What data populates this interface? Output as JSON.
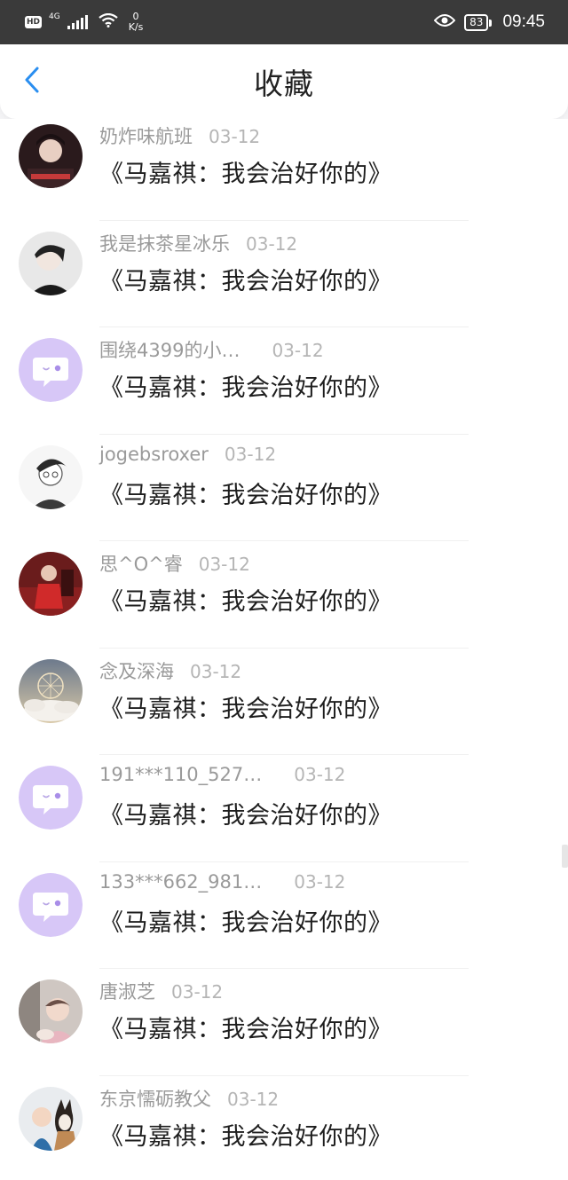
{
  "status_bar": {
    "hd": "HD",
    "network": "4G",
    "speed_value": "0",
    "speed_unit": "K/s",
    "battery": "83",
    "time": "09:45"
  },
  "header": {
    "title": "收藏"
  },
  "favorites": [
    {
      "name": "奶炸味航班",
      "date": "03-12",
      "content": "《马嘉祺：我会治好你的》",
      "avatar": "photo"
    },
    {
      "name": "我是抹茶星冰乐",
      "date": "03-12",
      "content": "《马嘉祺：我会治好你的》",
      "avatar": "photo"
    },
    {
      "name": "围绕4399的小…",
      "date": "03-12",
      "content": "《马嘉祺：我会治好你的》",
      "avatar": "default"
    },
    {
      "name": "jogebsroxer",
      "date": "03-12",
      "content": "《马嘉祺：我会治好你的》",
      "avatar": "photo"
    },
    {
      "name": "思^O^睿",
      "date": "03-12",
      "content": "《马嘉祺：我会治好你的》",
      "avatar": "photo"
    },
    {
      "name": "念及深海",
      "date": "03-12",
      "content": "《马嘉祺：我会治好你的》",
      "avatar": "photo"
    },
    {
      "name": "191***110_527…",
      "date": "03-12",
      "content": "《马嘉祺：我会治好你的》",
      "avatar": "default"
    },
    {
      "name": "133***662_981…",
      "date": "03-12",
      "content": "《马嘉祺：我会治好你的》",
      "avatar": "default"
    },
    {
      "name": "唐淑芝",
      "date": "03-12",
      "content": "《马嘉祺：我会治好你的》",
      "avatar": "photo"
    },
    {
      "name": "东京懦砺教父",
      "date": "03-12",
      "content": "《马嘉祺：我会治好你的》",
      "avatar": "photo"
    }
  ],
  "colors": {
    "accent": "#2a8ef0",
    "default_avatar_bg": "#d7c7f7",
    "status_bar_bg": "#3a3a3a"
  }
}
